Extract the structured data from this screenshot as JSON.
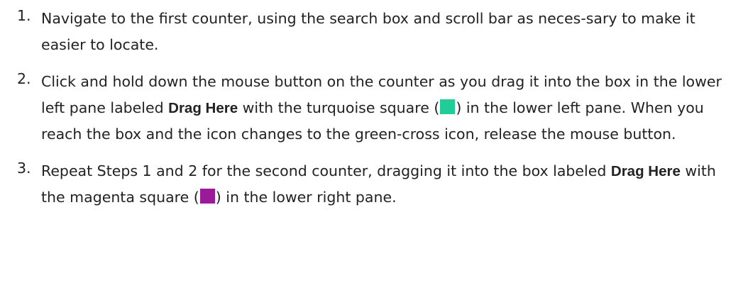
{
  "steps": [
    {
      "number": "1.",
      "text": "Navigate to the first counter, using the search box and scroll bar as neces-sary to make it easier to locate."
    },
    {
      "number": "2.",
      "text_a": "Click and hold down the mouse button on the counter as you drag it into the box in the lower left pane labeled ",
      "bold": "Drag Here",
      "text_b": " with the turquoise square (",
      "text_c": ") in the lower left pane. When you reach the box and the icon changes to the green-cross icon, release the mouse button.",
      "swatch_color": "#22cc99"
    },
    {
      "number": "3.",
      "text_a": "Repeat Steps 1 and 2 for the second counter, dragging it into the box labeled ",
      "bold": "Drag Here",
      "text_b": " with the magenta square (",
      "text_c": ") in the lower right pane.",
      "swatch_color": "#9a1a9a"
    }
  ]
}
